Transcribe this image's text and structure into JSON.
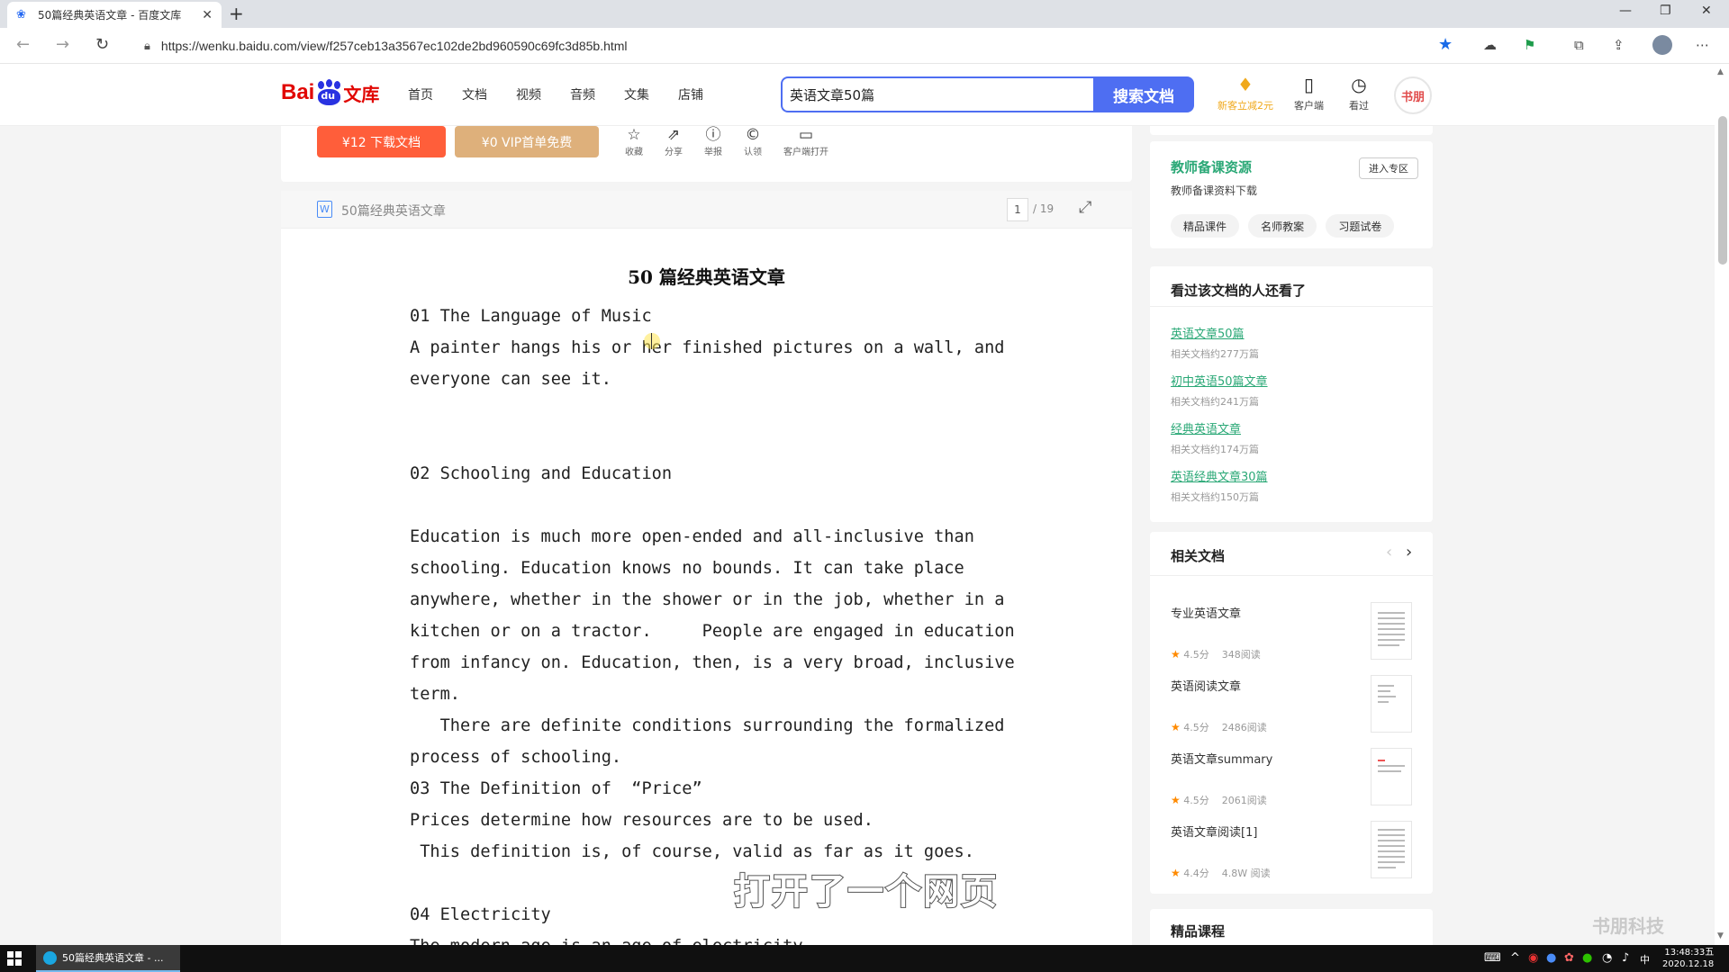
{
  "browser": {
    "tab_title": "50篇经典英语文章 - 百度文库",
    "url": "https://wenku.baidu.com/view/f257ceb13a3567ec102de2bd960590c69fc3d85b.html"
  },
  "header": {
    "logo_bai": "Bai",
    "logo_du": "du",
    "logo_wenku": "文库",
    "nav": [
      "首页",
      "文档",
      "视频",
      "音频",
      "文集",
      "店铺"
    ],
    "search_value": "英语文章50篇",
    "search_button": "搜索文档",
    "tools": {
      "vip": "新客立减2元",
      "client": "客户端",
      "history": "看过"
    },
    "avatar_text": "书朋"
  },
  "doc_toolbar": {
    "download": "¥12 下载文档",
    "vip_free": "¥0 VIP首单免费",
    "actions": [
      "收藏",
      "分享",
      "举报",
      "认领",
      "客户端打开"
    ]
  },
  "doc_bar": {
    "file_badge": "W",
    "doc_name": "50篇经典英语文章",
    "current_page": "1",
    "total_pages": "/ 19"
  },
  "document": {
    "title": "50 篇经典英语文章",
    "lines": [
      "01 The Language of Music",
      "A painter hangs his or her finished pictures on a wall, and",
      "everyone can see it.",
      "",
      "",
      "02 Schooling and Education",
      "",
      "Education is much more open-ended and all-inclusive than",
      "schooling. Education knows no bounds. It can take place",
      "anywhere, whether in the shower or in the job, whether in a",
      "kitchen or on a tractor.     People are engaged in education",
      "from infancy on. Education, then, is a very broad, inclusive",
      "term.",
      "   There are definite conditions surrounding the formalized",
      "process of schooling.",
      "03 The Definition of  “Price”",
      "Prices determine how resources are to be used.",
      " This definition is, of course, valid as far as it goes.",
      "",
      "04 Electricity",
      "The modern age is an age of electricity."
    ]
  },
  "sidebar": {
    "teacher": {
      "title": "教师备课资源",
      "subtitle": "教师备课资料下载",
      "enter": "进入专区",
      "pills": [
        "精品课件",
        "名师教案",
        "习题试卷"
      ]
    },
    "viewed": {
      "title": "看过该文档的人还看了",
      "items": [
        {
          "title": "英语文章50篇",
          "sub": "相关文档约277万篇"
        },
        {
          "title": "初中英语50篇文章",
          "sub": "相关文档约241万篇"
        },
        {
          "title": "经典英语文章",
          "sub": "相关文档约174万篇"
        },
        {
          "title": "英语经典文章30篇",
          "sub": "相关文档约150万篇"
        }
      ]
    },
    "related": {
      "title": "相关文档",
      "items": [
        {
          "title": "专业英语文章",
          "score": "4.5分",
          "reads": "348阅读"
        },
        {
          "title": "英语阅读文章",
          "score": "4.5分",
          "reads": "2486阅读"
        },
        {
          "title": "英语文章summary",
          "score": "4.5分",
          "reads": "2061阅读"
        },
        {
          "title": "英语文章阅读[1]",
          "score": "4.4分",
          "reads": "4.8W 阅读"
        }
      ]
    },
    "courses_title": "精品课程"
  },
  "overlay": {
    "subtitle": "打开了一个网页",
    "watermark": "书朋科技"
  },
  "taskbar": {
    "item": "50篇经典英语文章 - ...",
    "time": "13:48:33",
    "weekday": "五",
    "date": "2020.12.18"
  }
}
